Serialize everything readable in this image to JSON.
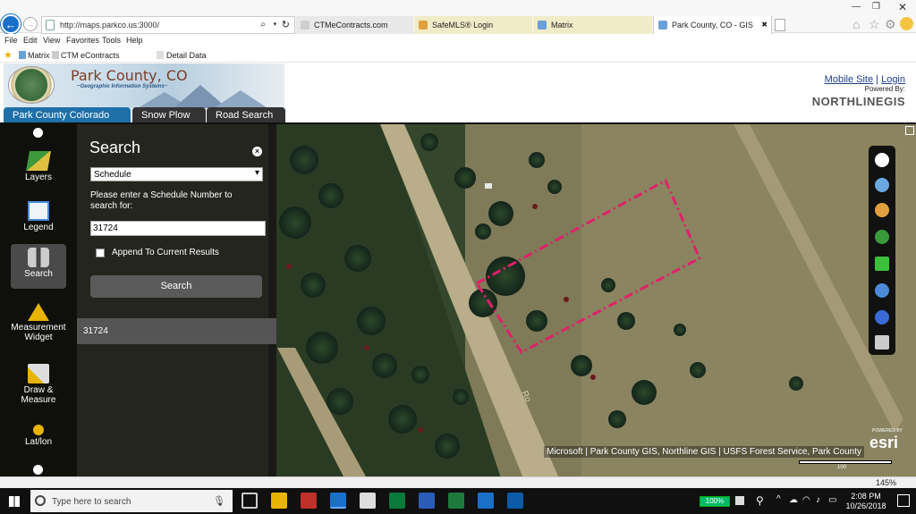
{
  "browser": {
    "url": "http://maps.parkco.us:3000/",
    "tabs": [
      {
        "label": "CTMeContracts.com",
        "color": "#e8e8e8",
        "iconColor": "#cfcfcf"
      },
      {
        "label": "SafeMLS® Login",
        "color": "#f1ecc8",
        "iconColor": "#e0a040"
      },
      {
        "label": "Matrix",
        "color": "#f1ecc8",
        "iconColor": "#6aa0d8"
      },
      {
        "label": "Park County, CO - GIS",
        "color": "#ffffff",
        "iconColor": "#6aa0d8",
        "close": "✖"
      }
    ],
    "menu": [
      "File",
      "Edit",
      "View",
      "Favorites",
      "Tools",
      "Help"
    ],
    "favorites": [
      "Matrix",
      "CTM eContracts",
      "Detail Data"
    ],
    "zoom_text": "145%"
  },
  "header": {
    "site_title": "Park County, CO",
    "site_subtitle": "~Geographic Information Systems~",
    "tabs": [
      {
        "label": "Park County Colorado",
        "active": true
      },
      {
        "label": "Snow Plow",
        "active": false
      },
      {
        "label": "Road Search",
        "active": false
      }
    ],
    "mobile_site": "Mobile Site",
    "login": "Login",
    "separator": "|",
    "powered_by": "Powered By:",
    "vendor": "NORTHLINEGIS"
  },
  "sidebar": {
    "tools": [
      {
        "label": "Layers",
        "icon": "layers-icon",
        "active": false
      },
      {
        "label": "Legend",
        "icon": "legend-icon",
        "active": false
      },
      {
        "label": "Search",
        "icon": "binoculars-icon",
        "active": true
      },
      {
        "label": "Measurement Widget",
        "icon": "ruler-icon",
        "active": false
      },
      {
        "label": "Draw & Measure",
        "icon": "brush-icon",
        "active": false
      },
      {
        "label": "Lat/lon",
        "icon": "pin-icon",
        "active": false
      }
    ]
  },
  "search_panel": {
    "title": "Search",
    "search_type": "Schedule",
    "prompt": "Please enter a Schedule Number to search for:",
    "input_value": "31724",
    "append_label": "Append To Current Results",
    "append_checked": false,
    "button_label": "Search",
    "results": [
      "31724"
    ]
  },
  "map": {
    "attribution": "Microsoft | Park County GIS, Northline GIS | USFS Forest Service, Park County",
    "esri_powered": "POWERED BY",
    "esri_logo": "esri",
    "scale_label": "100",
    "road_label": "Ro",
    "parcel_color": "#e0206a"
  },
  "taskbar": {
    "search_placeholder": "Type here to search",
    "battery": "100%",
    "time": "2:08 PM",
    "date": "10/26/2018"
  }
}
